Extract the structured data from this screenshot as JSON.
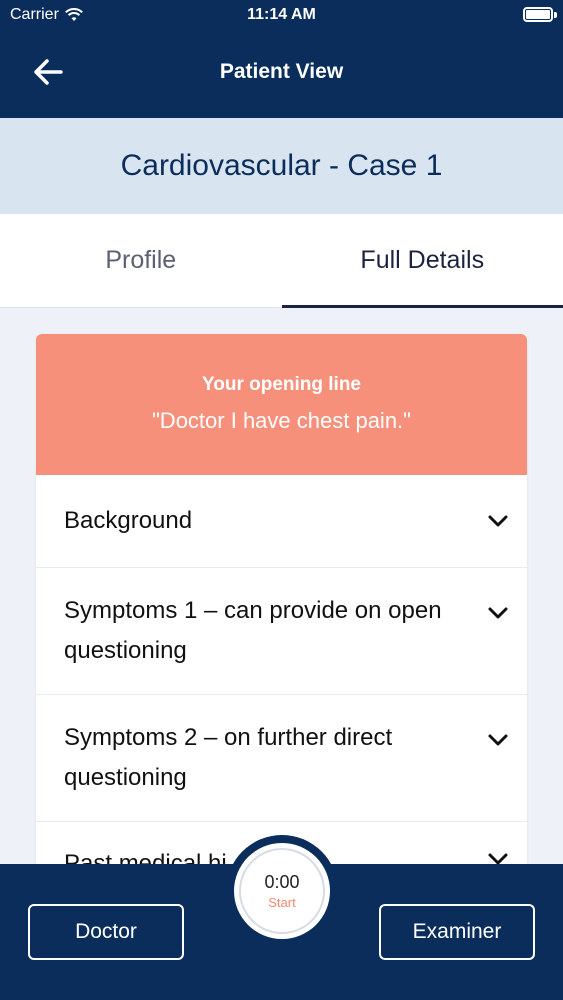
{
  "status_bar": {
    "carrier": "Carrier",
    "time": "11:14 AM"
  },
  "nav": {
    "title": "Patient View"
  },
  "case": {
    "title": "Cardiovascular - Case 1"
  },
  "tabs": [
    {
      "label": "Profile",
      "active": false
    },
    {
      "label": "Full Details",
      "active": true
    }
  ],
  "opening": {
    "label": "Your opening line",
    "quote": "\"Doctor I have chest pain.\""
  },
  "sections": [
    {
      "label": "Background"
    },
    {
      "label": "Symptoms 1 – can provide on open questioning"
    },
    {
      "label": "Symptoms 2 – on further direct questioning"
    },
    {
      "label": "Past medical hi"
    }
  ],
  "footer": {
    "doctor_label": "Doctor",
    "examiner_label": "Examiner"
  },
  "timer": {
    "time": "0:00",
    "action": "Start"
  },
  "colors": {
    "navy": "#0b2d5c",
    "coral": "#f7907b",
    "light_blue": "#d9e4f1"
  }
}
